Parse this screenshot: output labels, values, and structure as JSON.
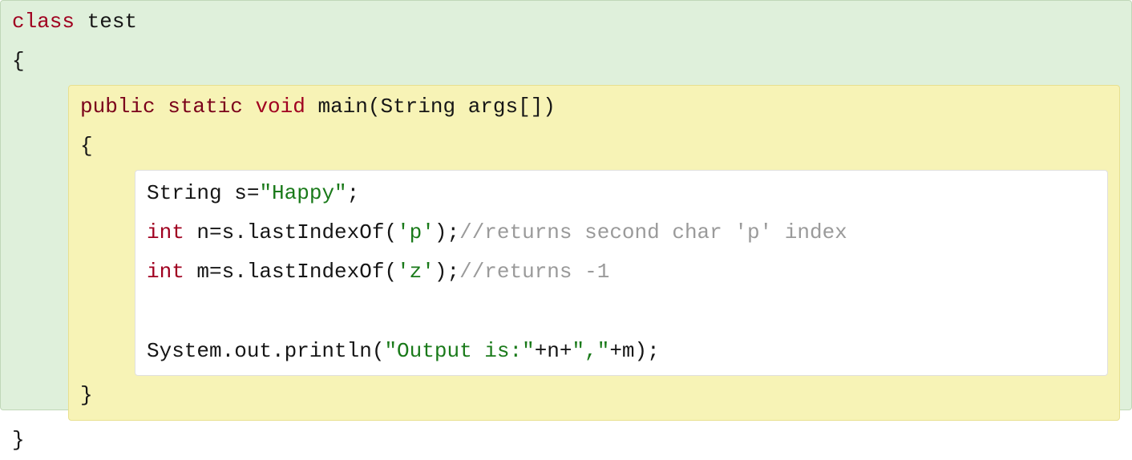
{
  "outer": {
    "kw_class": "class",
    "class_name": " test",
    "open_brace": "{",
    "close_brace": "}"
  },
  "middle": {
    "kw_public": "public",
    "kw_static": " static",
    "kw_void": " void",
    "sig": " main(String args[])",
    "open_brace": "{",
    "close_brace": "}"
  },
  "inner": {
    "line1_a": "String s=",
    "line1_str": "\"Happy\"",
    "line1_b": ";",
    "line2_kw": "int",
    "line2_a": " n=s.lastIndexOf(",
    "line2_str": "'p'",
    "line2_b": ");",
    "line2_c": "//returns second char 'p' index",
    "line3_kw": "int",
    "line3_a": " m=s.lastIndexOf(",
    "line3_str": "'z'",
    "line3_b": ");",
    "line3_c": "//returns -1",
    "blank": " ",
    "line5_a": "System.out.println(",
    "line5_str1": "\"Output is:\"",
    "line5_b": "+n+",
    "line5_str2": "\",\"",
    "line5_c": "+m);"
  }
}
